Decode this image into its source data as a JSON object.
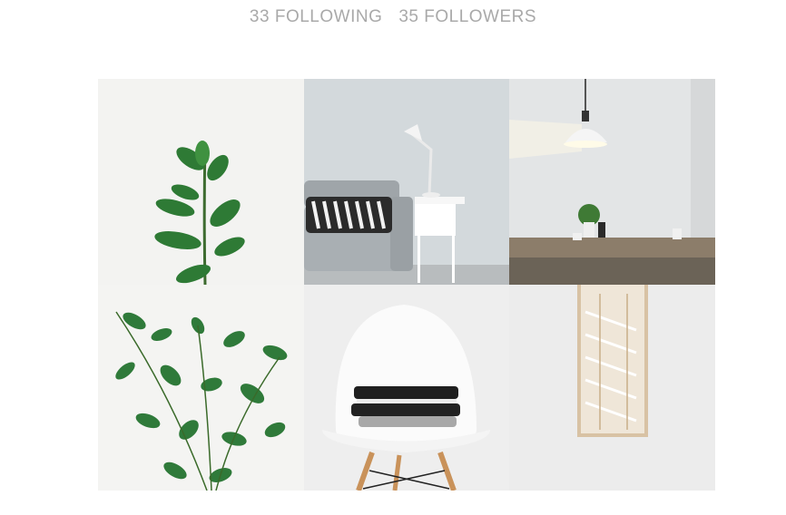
{
  "profile": {
    "following_label": "33 FOLLOWING",
    "followers_label": "35 FOLLOWERS"
  },
  "gallery": {
    "items": [
      {
        "subject": "rubber plant stem on white background"
      },
      {
        "subject": "grey sofa with patterned pillow and desk lamp"
      },
      {
        "subject": "white pendant lamp over wooden table"
      },
      {
        "subject": "leafy green plant branches"
      },
      {
        "subject": "white chair with folded towels"
      },
      {
        "subject": "mirror reflecting white staircase"
      }
    ]
  },
  "colors": {
    "stat_text": "#a9a9a9",
    "plant_green": "#2f7a3a",
    "sofa_grey": "#a6acb0",
    "wall_blue_grey": "#cfd6d9"
  }
}
